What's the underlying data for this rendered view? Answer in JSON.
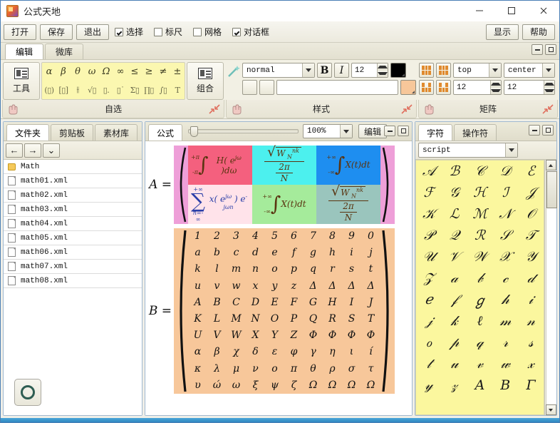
{
  "window": {
    "title": "公式天地",
    "minimize": "–",
    "maximize": "□",
    "close": "✕"
  },
  "maintoolbar": {
    "buttons": [
      {
        "label": "打开",
        "name": "open-button"
      },
      {
        "label": "保存",
        "name": "save-button"
      },
      {
        "label": "退出",
        "name": "exit-button"
      }
    ],
    "checkboxes": [
      {
        "label": "选择",
        "checked": true,
        "name": "select-checkbox"
      },
      {
        "label": "标尺",
        "checked": false,
        "name": "ruler-checkbox"
      },
      {
        "label": "网格",
        "checked": false,
        "name": "grid-checkbox"
      },
      {
        "label": "对话框",
        "checked": true,
        "name": "dialog-checkbox"
      }
    ],
    "right_buttons": [
      {
        "label": "显示",
        "name": "display-button"
      },
      {
        "label": "帮助",
        "name": "help-button"
      }
    ]
  },
  "ribbon": {
    "tabs": [
      {
        "label": "编辑",
        "active": true
      },
      {
        "label": "微库",
        "active": false
      }
    ],
    "tools_button": "工具",
    "combine_button": "组合",
    "group_captions": {
      "custom": "自选",
      "style": "样式",
      "matrix": "矩阵"
    },
    "symbols_row1": [
      "α",
      "β",
      "θ",
      "ω",
      "Ω",
      "∞",
      "≤",
      "≥",
      "≠",
      "±"
    ],
    "symbols_row2": [
      "(▯)",
      "[▯]",
      "⫲",
      "√▯",
      "▯.",
      "▯˙",
      "Σ▯",
      "∏▯",
      "∫▯",
      "T"
    ],
    "style": {
      "font_style": "normal",
      "bold": "B",
      "italic": "I",
      "size": "12",
      "text_color": "#000000",
      "fill_color": "#f7c79a",
      "text_value": ""
    },
    "matrix": {
      "valign": "top",
      "halign": "center",
      "rows": "12",
      "cols": "12"
    }
  },
  "left_panel": {
    "tabs": [
      {
        "label": "文件夹",
        "active": true
      },
      {
        "label": "剪贴板",
        "active": false
      },
      {
        "label": "素材库",
        "active": false
      }
    ],
    "nav": {
      "back": "←",
      "forward": "→",
      "down": "⌄"
    },
    "files": [
      {
        "name": "Math",
        "type": "folder"
      },
      {
        "name": "math01.xml",
        "type": "file"
      },
      {
        "name": "math02.xml",
        "type": "file"
      },
      {
        "name": "math03.xml",
        "type": "file"
      },
      {
        "name": "math04.xml",
        "type": "file"
      },
      {
        "name": "math05.xml",
        "type": "file"
      },
      {
        "name": "math06.xml",
        "type": "file"
      },
      {
        "name": "math07.xml",
        "type": "file"
      },
      {
        "name": "math08.xml",
        "type": "file"
      }
    ]
  },
  "center_panel": {
    "tab": "公式",
    "zoom": "100%",
    "edit_button": "编辑",
    "matrix_a": {
      "label": "A =",
      "bg": "#f59b86",
      "paren_bg": "#ee9fd8",
      "cells": [
        {
          "kind": "integral",
          "lower": "-π",
          "upper": "+π",
          "body": "H( e^{jω} )dω",
          "bg": "#f4607e"
        },
        {
          "kind": "fraction",
          "num": "√W_N^{nk}",
          "den": "2π/N",
          "bg": "#4cf0ee"
        },
        {
          "kind": "integral",
          "lower": "-∞",
          "upper": "+∞",
          "body": "X(t)dt",
          "bg": "#1e8ef0"
        },
        {
          "kind": "sum",
          "lower": "n=-∞",
          "upper": "+∞",
          "body": "x( e^{jω} ) e^{-jωn}",
          "bg": "#ffe3ea"
        },
        {
          "kind": "integral",
          "lower": "-∞",
          "upper": "+∞",
          "body": "X(t)dt",
          "bg": "#a5eb9b"
        },
        {
          "kind": "fraction",
          "num": "√W_N^{nk}",
          "den": "2π/N",
          "bg": "#9ac5bd"
        }
      ]
    },
    "matrix_b": {
      "label": "B =",
      "bg": "#f7c79a",
      "rows": [
        [
          "1",
          "2",
          "3",
          "4",
          "5",
          "6",
          "7",
          "8",
          "9",
          "0"
        ],
        [
          "a",
          "b",
          "c",
          "d",
          "e",
          "f",
          "g",
          "h",
          "i",
          "j"
        ],
        [
          "k",
          "l",
          "m",
          "n",
          "o",
          "p",
          "q",
          "r",
          "s",
          "t"
        ],
        [
          "u",
          "v",
          "w",
          "x",
          "y",
          "z",
          "Δ",
          "Δ",
          "Δ",
          "Δ"
        ],
        [
          "A",
          "B",
          "C",
          "D",
          "E",
          "F",
          "G",
          "H",
          "I",
          "J"
        ],
        [
          "K",
          "L",
          "M",
          "N",
          "O",
          "P",
          "Q",
          "R",
          "S",
          "T"
        ],
        [
          "U",
          "V",
          "W",
          "X",
          "Y",
          "Z",
          "Φ",
          "Φ",
          "Φ",
          "Φ"
        ],
        [
          "α",
          "β",
          "χ",
          "δ",
          "ε",
          "φ",
          "γ",
          "η",
          "ι",
          "í"
        ],
        [
          "κ",
          "λ",
          "μ",
          "ν",
          "ο",
          "π",
          "θ",
          "ρ",
          "σ",
          "τ"
        ],
        [
          "υ",
          "ώ",
          "ω",
          "ξ",
          "ψ",
          "ζ",
          "Ω",
          "Ω",
          "Ω",
          "Ω"
        ]
      ]
    }
  },
  "right_panel": {
    "tabs": [
      {
        "label": "字符",
        "active": true
      },
      {
        "label": "操作符",
        "active": false
      }
    ],
    "category": "script",
    "characters": [
      "𝒜",
      "ℬ",
      "𝒞",
      "𝒟",
      "ℰ",
      "ℱ",
      "𝒢",
      "ℋ",
      "ℐ",
      "𝒥",
      "𝒦",
      "ℒ",
      "ℳ",
      "𝒩",
      "𝒪",
      "𝒫",
      "𝒬",
      "ℛ",
      "𝒮",
      "𝒯",
      "𝒰",
      "𝒱",
      "𝒲",
      "𝒳",
      "𝒴",
      "𝒵",
      "𝒶",
      "𝒷",
      "𝒸",
      "𝒹",
      "ℯ",
      "𝒻",
      "ℊ",
      "𝒽",
      "𝒾",
      "𝒿",
      "𝓀",
      "ℓ",
      "𝓂",
      "𝓃",
      "ℴ",
      "𝓅",
      "𝓆",
      "𝓇",
      "𝓈",
      "𝓉",
      "𝓊",
      "𝓋",
      "𝓌",
      "𝓍",
      "𝓎",
      "𝓏",
      "Α",
      "Β",
      "Γ"
    ]
  }
}
